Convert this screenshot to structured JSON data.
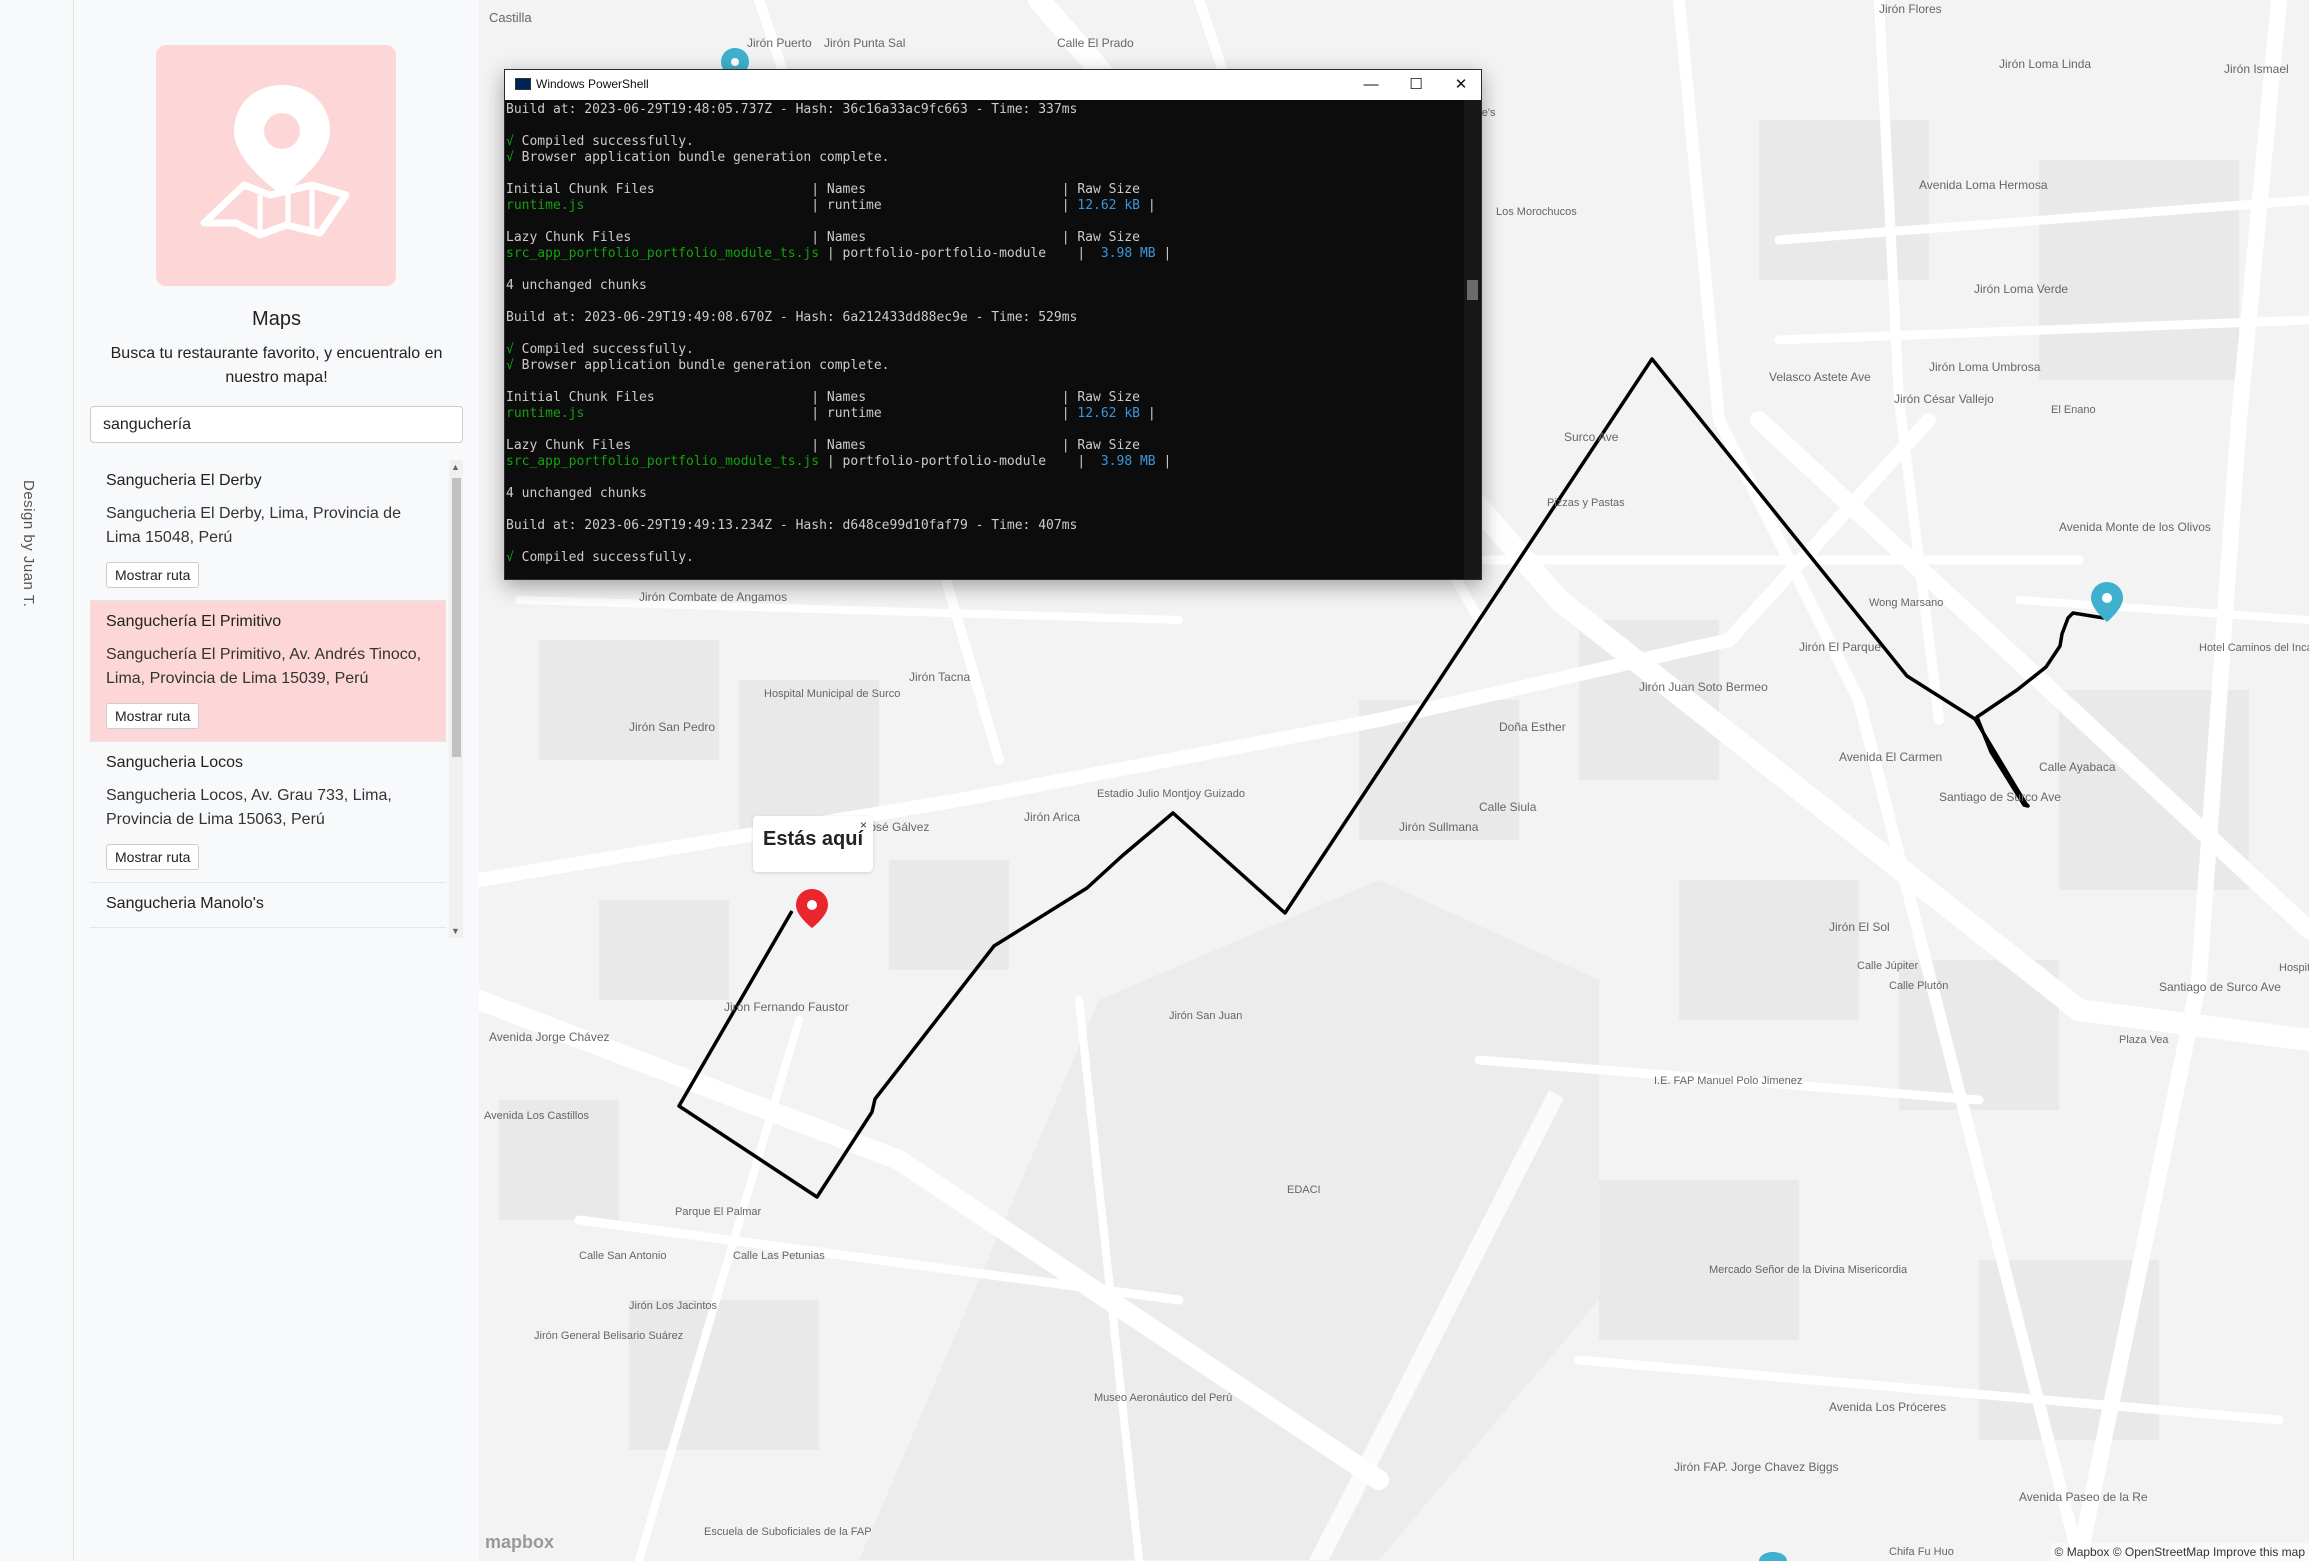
{
  "strip": {
    "credit": "Design by Juan T."
  },
  "panel": {
    "title": "Maps",
    "subtitle": "Busca tu restaurante favorito, y encuentralo en nuestro mapa!",
    "search_value": "sanguchería",
    "items": [
      {
        "name": "Sangucheria El Derby",
        "address": "Sangucheria El Derby, Lima, Provincia de Lima 15048, Perú",
        "button": "Mostrar ruta",
        "active": false
      },
      {
        "name": "Sanguchería El Primitivo",
        "address": "Sanguchería El Primitivo, Av. Andrés Tinoco, Lima, Provincia de Lima 15039, Perú",
        "button": "Mostrar ruta",
        "active": true
      },
      {
        "name": "Sangucheria Locos",
        "address": "Sangucheria Locos, Av. Grau 733, Lima, Provincia de Lima 15063, Perú",
        "button": "Mostrar ruta",
        "active": false
      },
      {
        "name": "Sangucheria Manolo's",
        "address": "",
        "button": "",
        "active": false
      }
    ]
  },
  "map": {
    "popup_text": "Estás aquí",
    "popup_close": "×",
    "logo": "mapbox",
    "attribution": "© Mapbox © OpenStreetMap  Improve this map",
    "route_color": "#000000",
    "marker_color": "#e8262b",
    "pin_color": "#3fb1ce",
    "labels": [
      "Castilla",
      "Jirón Puerto",
      "Jirón Punta Sal",
      "Calle El Prado",
      "Jirón Flores",
      "Jirón Loma Linda",
      "Jirón Ismael",
      "Hollywood Suite's",
      "Los Morochucos",
      "Avenida Loma Hermosa",
      "Jirón Loma Verde",
      "Jirón Loma Umbrosa",
      "Jirón César Vallejo",
      "El Enano",
      "Velasco Astete Ave",
      "Avenida Monte de los Olivos",
      "Pizzas y Pastas",
      "Surco Ave",
      "Wong Marsano",
      "Hotel Caminos del Inca Inn",
      "Jirón Combate de Angamos",
      "Jirón Tacna",
      "Hospital Municipal de Surco",
      "Jirón San Pedro",
      "Jirón José Gálvez",
      "Jirón Arica",
      "Estadio Julio Montjoy Guizado",
      "Jirón Juan Soto Bermeo",
      "Doña Esther",
      "Calle Siula",
      "Jirón Sullmana",
      "Jirón El Parque",
      "Avenida El Carmen",
      "Santiago de Surco Ave",
      "Calle Ayabaca",
      "Jirón El Sol",
      "Calle Júpiter",
      "Calle Plutón",
      "Plaza Vea",
      "Jirón Fernando Faustor",
      "Avenida Jorge Chávez",
      "Jirón San Juan",
      "I.E. FAP Manuel Polo Jimenez",
      "EDACI",
      "Parque El Palmar",
      "Calle Las Petunias",
      "Calle San Antonio",
      "Jirón Los Jacintos",
      "Jirón General Belisario Suárez",
      "Avenida Los Castillos",
      "Mercado Señor de la Divina Misericordia",
      "Museo Aeronáutico del Perú",
      "Escuela de Suboficiales de la FAP",
      "Avenida Los Próceres",
      "Jirón FAP. Jorge Chavez Biggs",
      "Chifa Fu Huo",
      "Avenida Paseo de la Re",
      "Hospit",
      "Santiago de Surco Ave"
    ]
  },
  "powershell": {
    "title": "Windows PowerShell",
    "minimize": "—",
    "maximize": "☐",
    "close": "✕",
    "lines": [
      [
        {
          "t": "Build at: 2023-06-29T19:48:05.737Z - Hash: 36c16a33ac9fc663 - Time: 337ms"
        }
      ],
      [
        {
          "t": ""
        }
      ],
      [
        {
          "t": "√ ",
          "c": "g"
        },
        {
          "t": "Compiled successfully."
        }
      ],
      [
        {
          "t": "√ ",
          "c": "g"
        },
        {
          "t": "Browser application bundle generation complete."
        }
      ],
      [
        {
          "t": ""
        }
      ],
      [
        {
          "t": "Initial Chunk Files                    | Names                         | Raw Size"
        }
      ],
      [
        {
          "t": "runtime.js",
          "c": "g"
        },
        {
          "t": "                             | runtime                       | "
        },
        {
          "t": "12.62 kB",
          "c": "c"
        },
        {
          "t": " |"
        }
      ],
      [
        {
          "t": ""
        }
      ],
      [
        {
          "t": "Lazy Chunk Files                       | Names                         | Raw Size"
        }
      ],
      [
        {
          "t": "src_app_portfolio_portfolio_module_ts.js",
          "c": "g"
        },
        {
          "t": " | portfolio-portfolio-module    |  "
        },
        {
          "t": "3.98 MB",
          "c": "c"
        },
        {
          "t": " |"
        }
      ],
      [
        {
          "t": ""
        }
      ],
      [
        {
          "t": "4 unchanged chunks"
        }
      ],
      [
        {
          "t": ""
        }
      ],
      [
        {
          "t": "Build at: 2023-06-29T19:49:08.670Z - Hash: 6a212433dd88ec9e - Time: 529ms"
        }
      ],
      [
        {
          "t": ""
        }
      ],
      [
        {
          "t": "√ ",
          "c": "g"
        },
        {
          "t": "Compiled successfully."
        }
      ],
      [
        {
          "t": "√ ",
          "c": "g"
        },
        {
          "t": "Browser application bundle generation complete."
        }
      ],
      [
        {
          "t": ""
        }
      ],
      [
        {
          "t": "Initial Chunk Files                    | Names                         | Raw Size"
        }
      ],
      [
        {
          "t": "runtime.js",
          "c": "g"
        },
        {
          "t": "                             | runtime                       | "
        },
        {
          "t": "12.62 kB",
          "c": "c"
        },
        {
          "t": " |"
        }
      ],
      [
        {
          "t": ""
        }
      ],
      [
        {
          "t": "Lazy Chunk Files                       | Names                         | Raw Size"
        }
      ],
      [
        {
          "t": "src_app_portfolio_portfolio_module_ts.js",
          "c": "g"
        },
        {
          "t": " | portfolio-portfolio-module    |  "
        },
        {
          "t": "3.98 MB",
          "c": "c"
        },
        {
          "t": " |"
        }
      ],
      [
        {
          "t": ""
        }
      ],
      [
        {
          "t": "4 unchanged chunks"
        }
      ],
      [
        {
          "t": ""
        }
      ],
      [
        {
          "t": "Build at: 2023-06-29T19:49:13.234Z - Hash: d648ce99d10faf79 - Time: 407ms"
        }
      ],
      [
        {
          "t": ""
        }
      ],
      [
        {
          "t": "√ ",
          "c": "g"
        },
        {
          "t": "Compiled successfully."
        }
      ],
      [
        {
          "t": ""
        }
      ]
    ]
  }
}
